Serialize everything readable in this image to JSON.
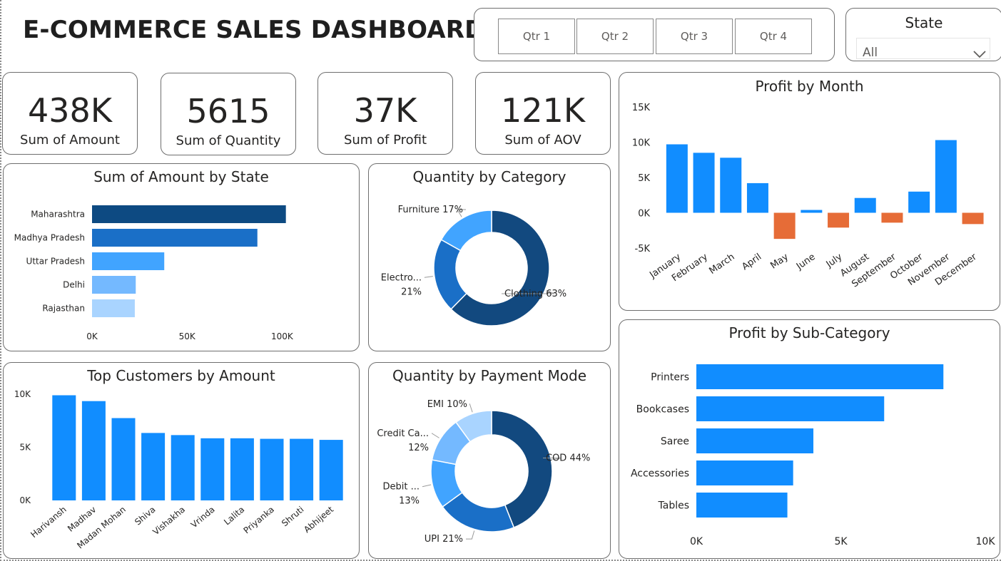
{
  "title": "E-COMMERCE SALES DASHBOARD",
  "quarters": [
    "Qtr 1",
    "Qtr 2",
    "Qtr 3",
    "Qtr 4"
  ],
  "state_filter": {
    "label": "State",
    "value": "All",
    "icon": "chevron-down-icon"
  },
  "kpis": [
    {
      "value": "438K",
      "label": "Sum of Amount"
    },
    {
      "value": "5615",
      "label": "Sum of Quantity"
    },
    {
      "value": "37K",
      "label": "Sum of Profit"
    },
    {
      "value": "121K",
      "label": "Sum of AOV"
    }
  ],
  "colors": {
    "bar_blue": "#118dff",
    "negative": "#e66c37",
    "navy": "#12497f",
    "mid_blue": "#1a6fc7",
    "light_blue": "#41a4ff",
    "pale_blue": "#a9d4ff"
  },
  "chart_data": [
    {
      "id": "amount_by_state",
      "type": "bar",
      "orientation": "horizontal",
      "title": "Sum of Amount by State",
      "categories": [
        "Maharashtra",
        "Madhya Pradesh",
        "Uttar Pradesh",
        "Delhi",
        "Rajasthan"
      ],
      "values": [
        102000,
        87000,
        38000,
        23000,
        22500
      ],
      "colors": [
        "#0d4a82",
        "#1a6fc7",
        "#41a4ff",
        "#74b9ff",
        "#a9d4ff"
      ],
      "xlim": [
        0,
        110000
      ],
      "ticks": [
        0,
        50000,
        100000
      ],
      "tick_labels": [
        "0K",
        "50K",
        "100K"
      ]
    },
    {
      "id": "quantity_by_category",
      "type": "pie",
      "donut": true,
      "title": "Quantity by Category",
      "labels": [
        "Clothing",
        "Electronics",
        "Furniture"
      ],
      "values": [
        63,
        21,
        17
      ],
      "label_text": [
        "Clothing 63%",
        "Electro...",
        "Furniture 17%"
      ],
      "label_text_2": [
        "",
        "21%",
        ""
      ],
      "colors": [
        "#12497f",
        "#1a6fc7",
        "#41a4ff"
      ]
    },
    {
      "id": "top_customers",
      "type": "bar",
      "title": "Top Customers by Amount",
      "categories": [
        "Harivansh",
        "Madhav",
        "Madan Mohan",
        "Shiva",
        "Vishakha",
        "Vrinda",
        "Lalita",
        "Priyanka",
        "Shruti",
        "Abhijeet"
      ],
      "values": [
        9900,
        9350,
        7750,
        6350,
        6150,
        5850,
        5850,
        5800,
        5800,
        5700
      ],
      "ylim": [
        0,
        10000
      ],
      "ticks": [
        0,
        5000,
        10000
      ],
      "tick_labels": [
        "0K",
        "5K",
        "10K"
      ],
      "color": "#118dff"
    },
    {
      "id": "quantity_by_payment",
      "type": "pie",
      "donut": true,
      "title": "Quantity by Payment Mode",
      "labels": [
        "COD",
        "UPI",
        "Debit Card",
        "Credit Card",
        "EMI"
      ],
      "values": [
        44,
        21,
        13,
        12,
        10
      ],
      "label_text": [
        "COD 44%",
        "UPI 21%",
        "Debit ...",
        "Credit Ca...",
        "EMI 10%"
      ],
      "label_text_2": [
        "",
        "",
        "13%",
        "12%",
        ""
      ],
      "colors": [
        "#12497f",
        "#1a6fc7",
        "#41a4ff",
        "#74b9ff",
        "#a9d4ff"
      ]
    },
    {
      "id": "profit_by_month",
      "type": "bar",
      "title": "Profit by Month",
      "categories": [
        "January",
        "February",
        "March",
        "April",
        "May",
        "June",
        "July",
        "August",
        "September",
        "October",
        "November",
        "December"
      ],
      "values": [
        9700,
        8500,
        7800,
        4200,
        -3700,
        400,
        -2100,
        2100,
        -1400,
        3000,
        10300,
        -1600
      ],
      "ylim": [
        -5000,
        15000
      ],
      "ticks": [
        -5000,
        0,
        5000,
        10000,
        15000
      ],
      "tick_labels": [
        "-5K",
        "0K",
        "5K",
        "10K",
        "15K"
      ],
      "positive_color": "#118dff",
      "negative_color": "#e66c37"
    },
    {
      "id": "profit_by_subcategory",
      "type": "bar",
      "orientation": "horizontal",
      "title": "Profit by Sub-Category",
      "categories": [
        "Printers",
        "Bookcases",
        "Saree",
        "Accessories",
        "Tables"
      ],
      "values": [
        8550,
        6500,
        4050,
        3350,
        3150
      ],
      "xlim": [
        0,
        10000
      ],
      "ticks": [
        0,
        5000,
        10000
      ],
      "tick_labels": [
        "0K",
        "5K",
        "10K"
      ],
      "color": "#118dff"
    }
  ]
}
